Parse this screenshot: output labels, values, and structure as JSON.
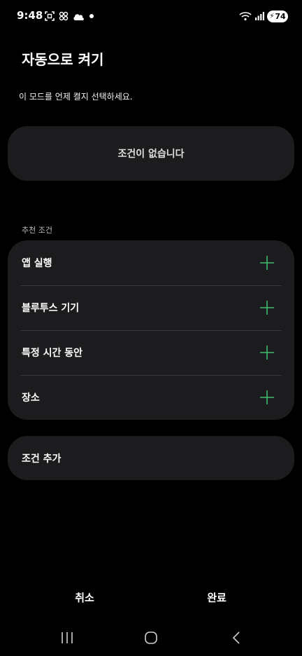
{
  "status_bar": {
    "time": "9:48",
    "battery_level": "74",
    "left_icons": [
      "screenshot-icon",
      "link-icon",
      "cloud-icon",
      "notification-dot-icon"
    ],
    "right_icons": [
      "wifi-icon",
      "signal-icon",
      "battery-icon"
    ]
  },
  "header": {
    "title": "자동으로 켜기",
    "description": "이 모드를 언제 켤지 선택하세요."
  },
  "conditions": {
    "empty_text": "조건이 없습니다"
  },
  "recommended": {
    "section_label": "추천 조건",
    "items": [
      {
        "label": "앱 실행",
        "icon": "plus-icon"
      },
      {
        "label": "블루투스 기기",
        "icon": "plus-icon"
      },
      {
        "label": "특정 시간 동안",
        "icon": "plus-icon"
      },
      {
        "label": "장소",
        "icon": "plus-icon"
      }
    ],
    "accent_color": "#3dbb6e"
  },
  "add_condition": {
    "label": "조건 추가"
  },
  "footer": {
    "cancel_label": "취소",
    "done_label": "완료"
  },
  "nav_bar": {
    "buttons": [
      "recent-apps-icon",
      "home-icon",
      "back-icon"
    ]
  }
}
